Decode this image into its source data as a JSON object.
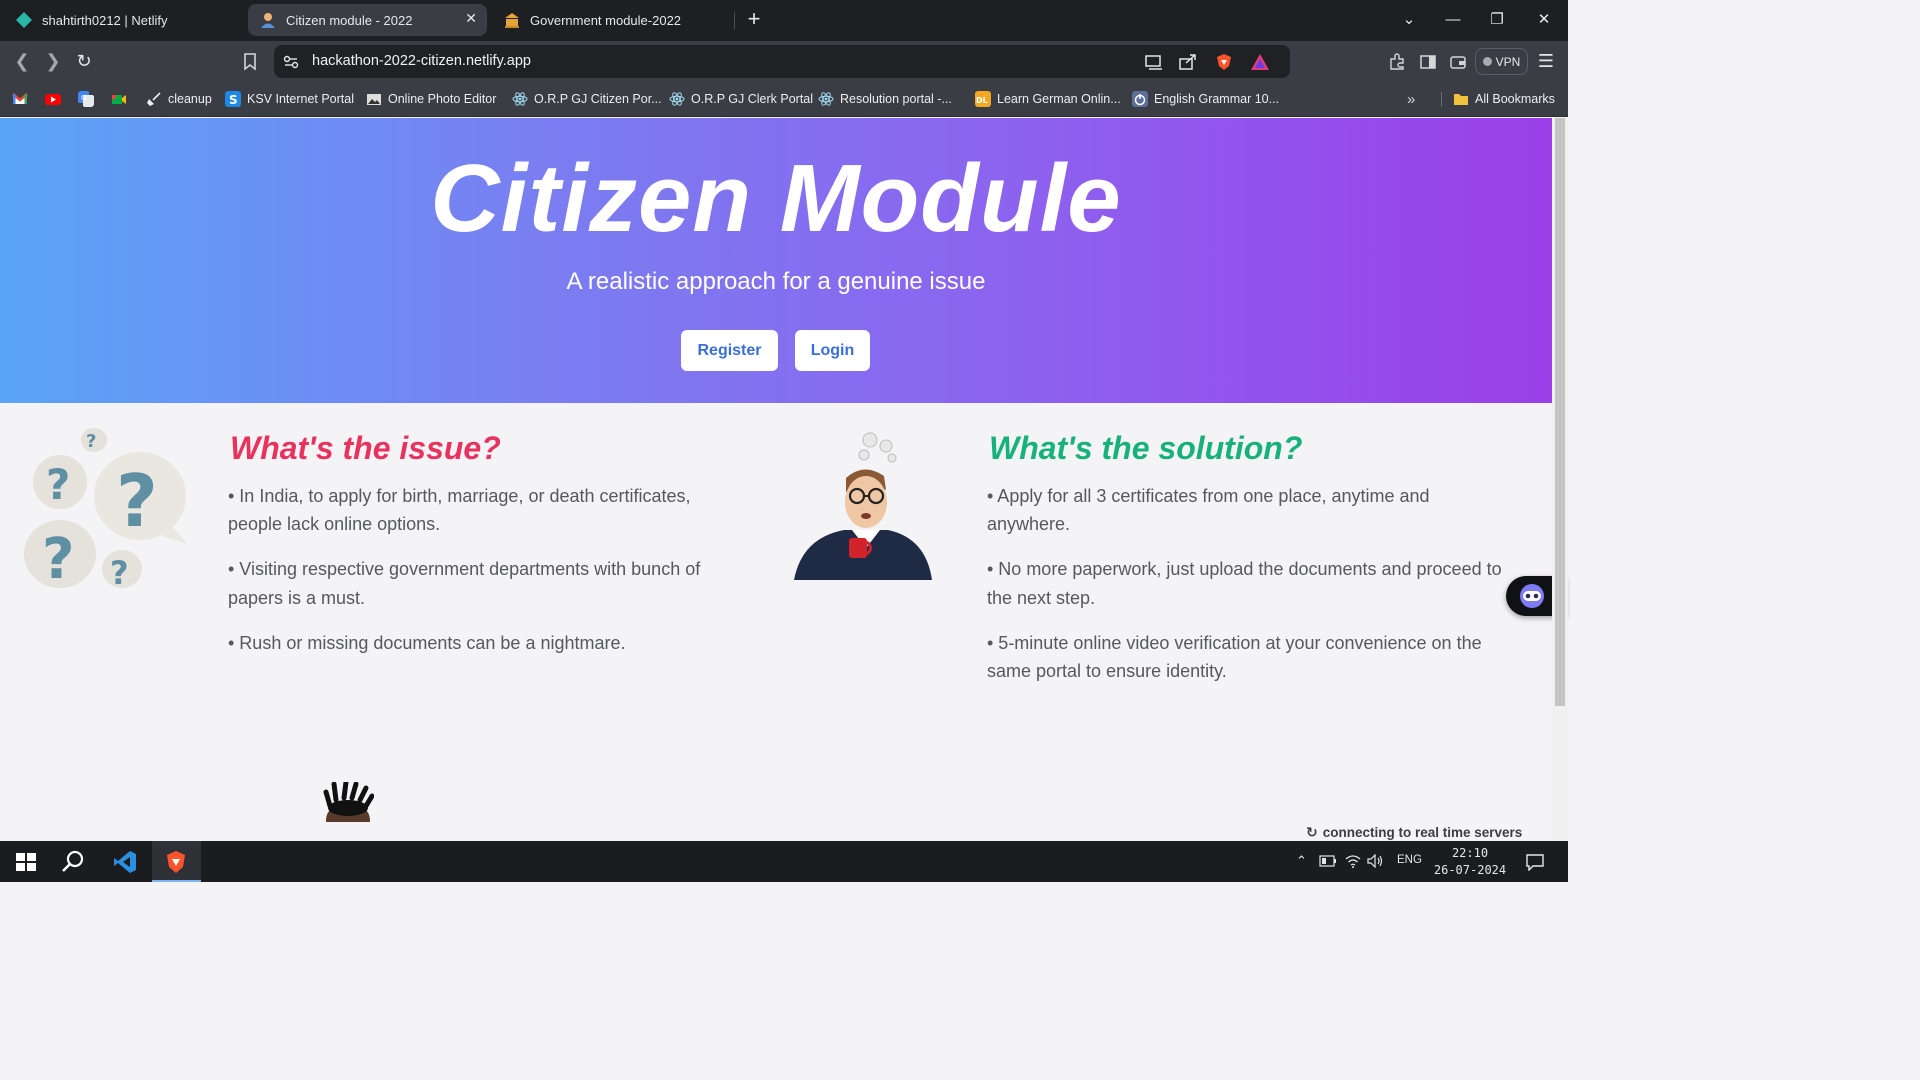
{
  "browser": {
    "tabs": [
      {
        "title": "shahtirth0212 | Netlify",
        "favicon": "netlify-icon"
      },
      {
        "title": "Citizen module - 2022",
        "favicon": "user-avatar-icon",
        "active": true
      },
      {
        "title": "Government module-2022",
        "favicon": "government-building-icon"
      }
    ],
    "new_tab_label": "+",
    "url": "hackathon-2022-citizen.netlify.app",
    "vpn_label": "VPN",
    "bookmarks": [
      {
        "label": "",
        "icon": "gmail-icon"
      },
      {
        "label": "",
        "icon": "youtube-icon"
      },
      {
        "label": "",
        "icon": "google-translate-icon"
      },
      {
        "label": "",
        "icon": "google-meet-icon"
      },
      {
        "label": "cleanup",
        "icon": "broom-icon"
      },
      {
        "label": "KSV Internet Portal",
        "icon": "ksv-icon"
      },
      {
        "label": "Online Photo Editor",
        "icon": "photo-editor-icon"
      },
      {
        "label": "O.R.P GJ Citizen Por...",
        "icon": "react-icon"
      },
      {
        "label": "O.R.P GJ Clerk Portal",
        "icon": "react-icon"
      },
      {
        "label": "Resolution portal -...",
        "icon": "react-icon"
      },
      {
        "label": "Learn German Onlin...",
        "icon": "dl-icon"
      },
      {
        "label": "English Grammar 10...",
        "icon": "power-icon"
      }
    ],
    "all_bookmarks_label": "All Bookmarks"
  },
  "hero": {
    "title": "Citizen Module",
    "subtitle": "A realistic approach for a genuine issue",
    "register_label": "Register",
    "login_label": "Login"
  },
  "issue": {
    "title": "What's the issue?",
    "bullets": [
      "• In India, to apply for birth, marriage, or death certificates,",
      "people lack online options.",
      "• Visiting respective government departments with bunch of",
      "papers is a must.",
      "• Rush or missing documents can be a nightmare."
    ]
  },
  "solution": {
    "title": "What's the solution?",
    "bullets": [
      "• Apply for all 3 certificates from one place, anytime and",
      "anywhere.",
      "• No more paperwork, just upload the documents and proceed to",
      "the next step.",
      "• 5-minute online video verification at your convenience on the",
      "same portal to ensure identity."
    ]
  },
  "status_text": "connecting to real time servers",
  "colors": {
    "issue_title": "#e8335e",
    "solution_title": "#17b27a",
    "button_text": "#3b6fd8"
  },
  "taskbar": {
    "language": "ENG",
    "time": "22:10",
    "date": "26-07-2024"
  }
}
